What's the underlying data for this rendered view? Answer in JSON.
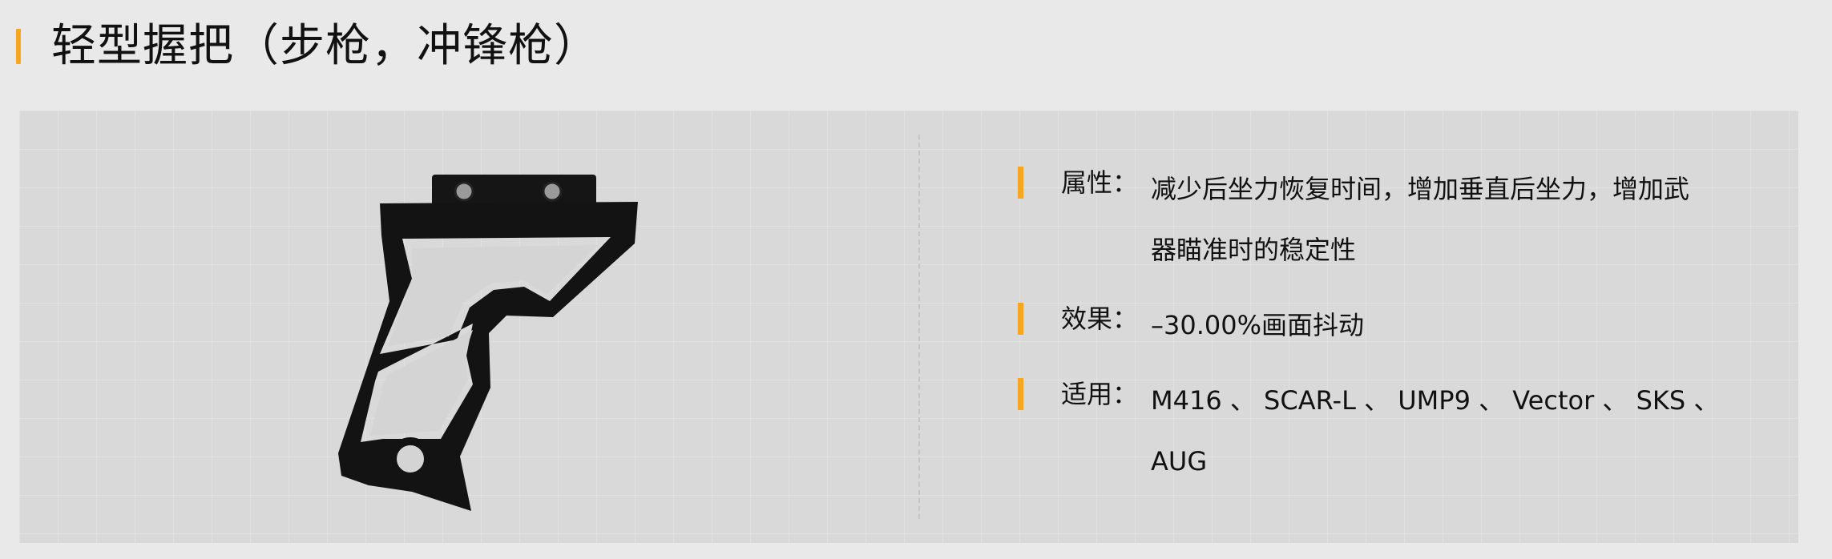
{
  "header": {
    "title": "轻型握把（步枪，冲锋枪）",
    "accent_color": "#f5a623"
  },
  "item": {
    "image_icon": "vertical-grip-icon"
  },
  "info": {
    "rows": [
      {
        "label": "属性：",
        "lines": [
          "减少后坐力恢复时间，增加垂直后坐力，增加武",
          "器瞄准时的稳定性"
        ]
      },
      {
        "label": "效果：",
        "lines": [
          "–30.00%画面抖动"
        ]
      },
      {
        "label": "适用：",
        "lines": [
          "M416 、 SCAR-L  、 UMP9 、 Vector 、 SKS 、",
          "AUG"
        ]
      }
    ]
  },
  "colors": {
    "background": "#e9e9e9",
    "card": "#d9d9d9",
    "accent": "#f5a623",
    "text": "#111111"
  }
}
